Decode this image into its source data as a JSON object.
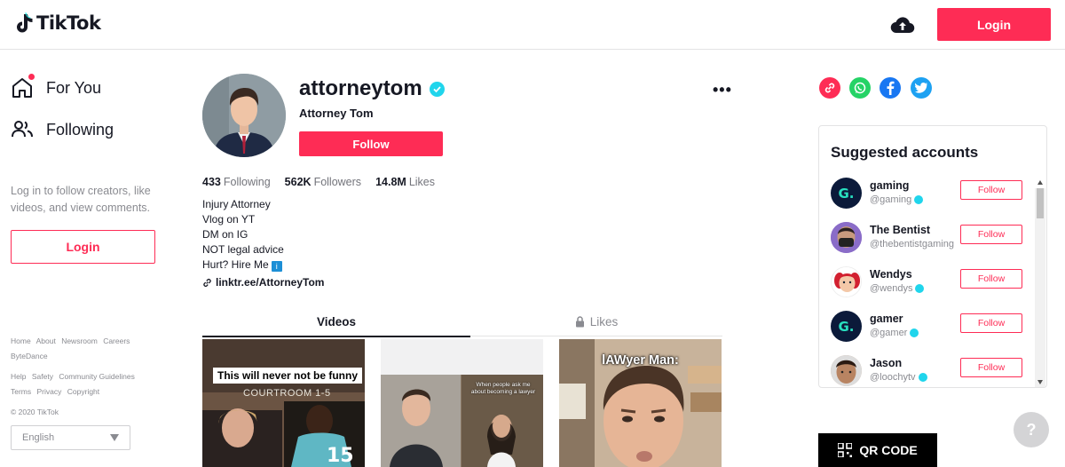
{
  "header": {
    "logo_text": "TikTok",
    "login_label": "Login"
  },
  "sidebar": {
    "nav": [
      {
        "label": "For You",
        "icon": "home-icon"
      },
      {
        "label": "Following",
        "icon": "users-icon"
      }
    ],
    "hint": "Log in to follow creators, like videos, and view comments.",
    "login_label": "Login",
    "footer_row1": [
      "Home",
      "About",
      "Newsroom",
      "Careers",
      "ByteDance"
    ],
    "footer_row2": [
      "Help",
      "Safety",
      "Community Guidelines",
      "Terms",
      "Privacy",
      "Copyright"
    ],
    "copyright": "© 2020 TikTok",
    "language": "English"
  },
  "profile": {
    "username": "attorneytom",
    "display_name": "Attorney Tom",
    "follow_label": "Follow",
    "more_label": "•••",
    "stats": {
      "following_count": "433",
      "following_label": "Following",
      "followers_count": "562K",
      "followers_label": "Followers",
      "likes_count": "14.8M",
      "likes_label": "Likes"
    },
    "bio": [
      "Injury Attorney",
      "Vlog on YT",
      "DM on IG",
      "NOT legal advice",
      "Hurt? Hire Me"
    ],
    "bio_badge": "i",
    "link": "linktr.ee/AttorneyTom"
  },
  "tabs": {
    "videos": "Videos",
    "likes": "Likes"
  },
  "videos": [
    {
      "caption": "This will never not be funny",
      "overlay": "COURTROOM 1-5"
    },
    {
      "caption": "When people ask me about becoming a lawyer"
    },
    {
      "caption": "lAWyer Man:"
    }
  ],
  "share": {
    "icons": [
      "link-icon",
      "whatsapp-icon",
      "facebook-icon",
      "twitter-icon"
    ],
    "colors": [
      "#fe2c55",
      "#25d366",
      "#1877f2",
      "#1da1f2"
    ]
  },
  "suggested": {
    "title": "Suggested accounts",
    "follow_label": "Follow",
    "accounts": [
      {
        "name": "gaming",
        "handle": "@gaming",
        "verified": true
      },
      {
        "name": "The Bentist",
        "handle": "@thebentistgaming",
        "verified": false
      },
      {
        "name": "Wendys",
        "handle": "@wendys",
        "verified": true
      },
      {
        "name": "gamer",
        "handle": "@gamer",
        "verified": true
      },
      {
        "name": "Jason",
        "handle": "@loochytv",
        "verified": true
      }
    ]
  },
  "qr_label": "QR CODE",
  "help_label": "?",
  "colors": {
    "accent": "#fe2c55",
    "verified": "#20d5ec"
  }
}
